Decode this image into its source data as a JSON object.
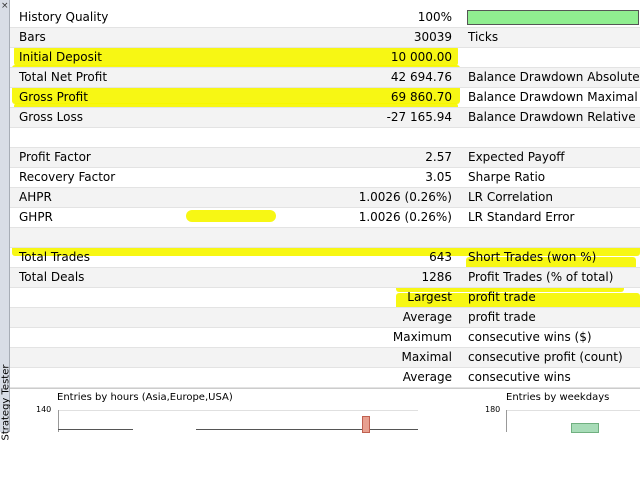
{
  "sidebar": {
    "close_glyph": "×",
    "panel_label": "Strategy Tester"
  },
  "rows": [
    {
      "label": "History Quality",
      "value": "100%",
      "right": ""
    },
    {
      "label": "Bars",
      "value": "30039",
      "right": "Ticks"
    },
    {
      "label": "Initial Deposit",
      "value": "10 000.00",
      "right": ""
    },
    {
      "label": "Total Net Profit",
      "value": "42 694.76",
      "right": "Balance Drawdown Absolute"
    },
    {
      "label": "Gross Profit",
      "value": "69 860.70",
      "right": "Balance Drawdown Maximal"
    },
    {
      "label": "Gross Loss",
      "value": "-27 165.94",
      "right": "Balance Drawdown Relative"
    },
    {
      "label": "",
      "value": "",
      "right": ""
    },
    {
      "label": "Profit Factor",
      "value": "2.57",
      "right": "Expected Payoff"
    },
    {
      "label": "Recovery Factor",
      "value": "3.05",
      "right": "Sharpe Ratio"
    },
    {
      "label": "AHPR",
      "value": "1.0026 (0.26%)",
      "right": "LR Correlation"
    },
    {
      "label": "GHPR",
      "value": "1.0026 (0.26%)",
      "right": "LR Standard Error"
    },
    {
      "label": "",
      "value": "",
      "right": ""
    },
    {
      "label": "Total Trades",
      "value": "643",
      "right": "Short Trades (won %)"
    },
    {
      "label": "Total Deals",
      "value": "1286",
      "right": "Profit Trades (% of total)"
    },
    {
      "label": "",
      "value": "Largest",
      "right": "profit trade"
    },
    {
      "label": "",
      "value": "Average",
      "right": "profit trade"
    },
    {
      "label": "",
      "value": "Maximum",
      "right": "consecutive wins ($)"
    },
    {
      "label": "",
      "value": "Maximal",
      "right": "consecutive profit (count)"
    },
    {
      "label": "",
      "value": "Average",
      "right": "consecutive wins"
    }
  ],
  "history_quality_fill": 1.0,
  "colors": {
    "highlight": "#f6f600",
    "quality_bar": "#90ee90",
    "hours_bar": "#e8a090",
    "weekday_bar": "#a8dcb8"
  },
  "charts": [
    {
      "chart_data": {
        "type": "bar",
        "title": "Entries by hours (Asia,Europe,USA)",
        "ytick_top": "140",
        "ylim": [
          0,
          140
        ]
      }
    },
    {
      "chart_data": {
        "type": "bar",
        "title": "Entries by weekdays",
        "ytick_top": "180",
        "ylim": [
          0,
          180
        ]
      }
    }
  ]
}
